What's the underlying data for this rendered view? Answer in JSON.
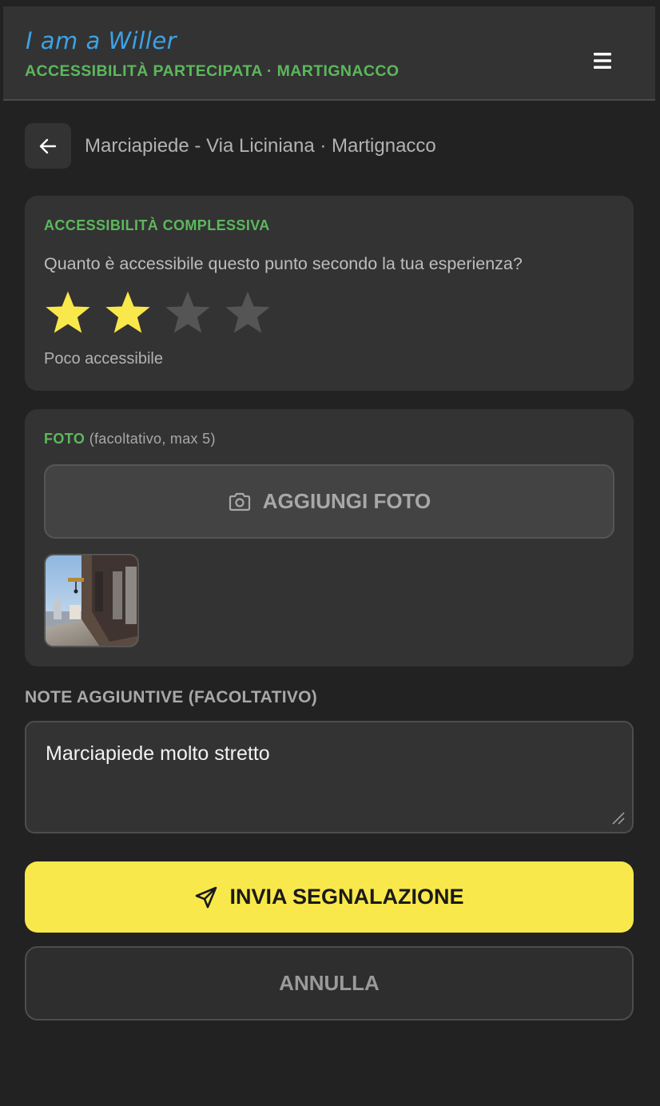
{
  "header": {
    "brand": "I am a Willer",
    "subtitle": "ACCESSIBILITÀ PARTECIPATA · MARTIGNACCO",
    "menu_icon": "hamburger-icon"
  },
  "titlebar": {
    "back_icon": "arrow-left-icon",
    "title": "Marciapiede - Via Liciniana · Martignacco"
  },
  "rating": {
    "label": "ACCESSIBILITÀ COMPLESSIVA",
    "question": "Quanto è accessibile questo punto secondo la tua esperienza?",
    "value": 2,
    "max": 5,
    "visible_stars": 4,
    "caption": "Poco accessibile",
    "colors": {
      "filled": "#f9e84b",
      "empty": "#555555"
    }
  },
  "photos": {
    "label": "FOTO",
    "label_extra": "(facoltativo, max 5)",
    "add_button_label": "AGGIUNGI FOTO",
    "add_button_icon": "camera-icon",
    "count": 1
  },
  "notes": {
    "label": "NOTE AGGIUNTIVE (FACOLTATIVO)",
    "value": "Marciapiede molto stretto"
  },
  "actions": {
    "submit_label": "INVIA SEGNALAZIONE",
    "submit_icon": "send-icon",
    "cancel_label": "ANNULLA"
  },
  "colors": {
    "accent_green": "#5cb85c",
    "brand_blue": "#3ba3e6",
    "primary_yellow": "#f9e84b",
    "background": "#222222",
    "card": "#333333"
  }
}
